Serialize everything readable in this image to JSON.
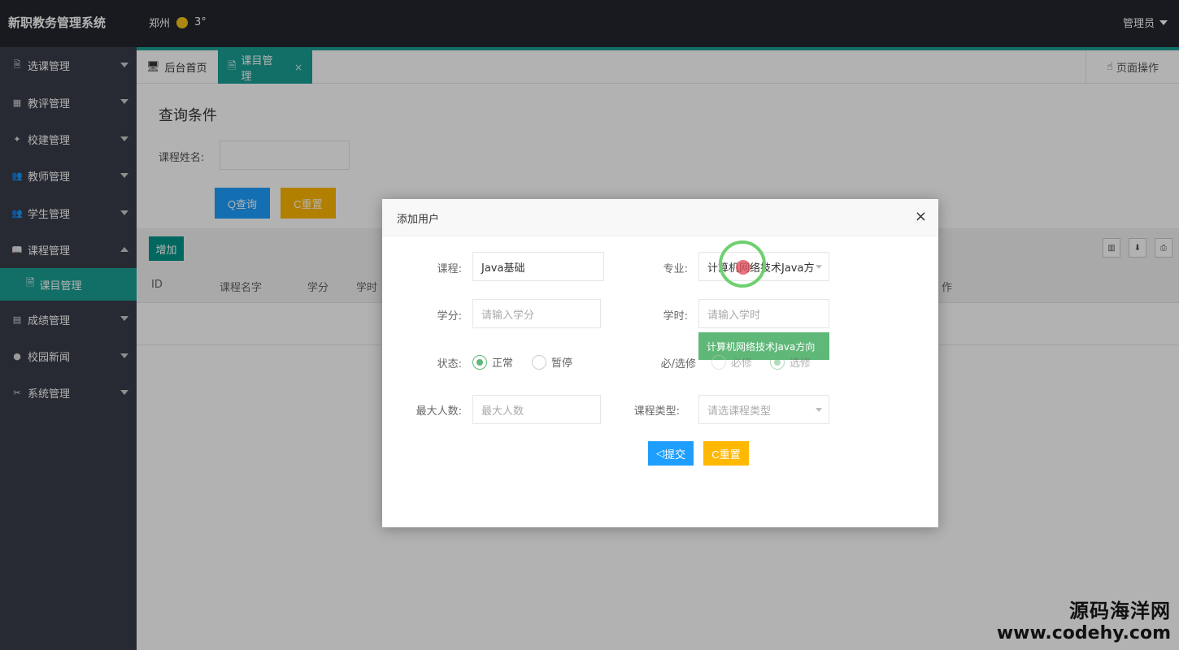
{
  "header": {
    "app_title": "新职教务管理系统",
    "city": "郑州",
    "temperature": "3°",
    "user": "管理员"
  },
  "sidebar": {
    "items": [
      {
        "label": "选课管理",
        "icon": "document-icon",
        "glyph": "🗎",
        "expanded": false
      },
      {
        "label": "教评管理",
        "icon": "grid-icon",
        "glyph": "▦",
        "expanded": false
      },
      {
        "label": "校建管理",
        "icon": "building-icon",
        "glyph": "✦",
        "expanded": false
      },
      {
        "label": "教师管理",
        "icon": "users-icon",
        "glyph": "👥",
        "expanded": false
      },
      {
        "label": "学生管理",
        "icon": "users-icon",
        "glyph": "👥",
        "expanded": false
      },
      {
        "label": "课程管理",
        "icon": "book-icon",
        "glyph": "📖",
        "expanded": true
      },
      {
        "label": "成绩管理",
        "icon": "report-icon",
        "glyph": "▤",
        "expanded": false
      },
      {
        "label": "校园新闻",
        "icon": "chat-icon",
        "glyph": "●",
        "expanded": false
      },
      {
        "label": "系统管理",
        "icon": "tools-icon",
        "glyph": "✂",
        "expanded": false
      }
    ],
    "sub_item": {
      "label": "课目管理",
      "icon": "document-icon"
    }
  },
  "tabs": {
    "home": "后台首页",
    "active": "课目管理",
    "close": "×",
    "page_ops": "页面操作"
  },
  "query": {
    "title": "查询条件",
    "course_name_label": "课程姓名:",
    "search_btn": "Q查询",
    "reset_btn": "C重置",
    "add_btn": "增加"
  },
  "table": {
    "columns": [
      "ID",
      "课程名字",
      "学分",
      "学时"
    ],
    "last_column": "作"
  },
  "modal": {
    "title": "添加用户",
    "close": "×",
    "course_label": "课程:",
    "course_value": "Java基础",
    "major_label": "专业:",
    "major_value": "计算机网络技术Java方",
    "credit_label": "学分:",
    "credit_placeholder": "请输入学分",
    "hours_label": "学时:",
    "hours_placeholder": "请输入学时",
    "dropdown_option": "计算机网络技术Java方向",
    "status_label": "状态:",
    "status_options": [
      "正常",
      "暂停"
    ],
    "status_selected": "正常",
    "required_label": "必/选修",
    "required_options": [
      "必修",
      "选修"
    ],
    "required_selected": "选修",
    "max_label": "最大人数:",
    "max_placeholder": "最大人数",
    "type_label": "课程类型:",
    "type_placeholder": "请选课程类型",
    "submit_btn": "提交",
    "reset_btn": "C重置"
  },
  "watermark": {
    "cn": "源码海洋网",
    "url": "www.codehy.com"
  },
  "colors": {
    "teal": "#1aa094",
    "blue": "#1e9fff",
    "yellow": "#ffb800",
    "green": "#5fb878",
    "sidebar": "#393d49"
  }
}
